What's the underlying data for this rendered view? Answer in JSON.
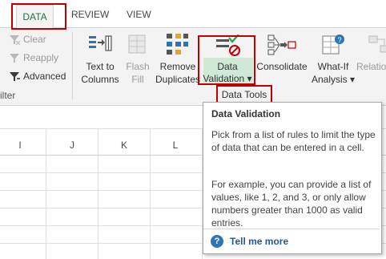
{
  "tabs": {
    "data": "DATA",
    "review": "REVIEW",
    "view": "VIEW"
  },
  "sort_filter": {
    "clear": "Clear",
    "reapply": "Reapply",
    "advanced": "Advanced",
    "group_label_partial": "ilter"
  },
  "buttons": {
    "text_to_columns": [
      "Text to",
      "Columns"
    ],
    "flash_fill": [
      "Flash",
      "Fill"
    ],
    "remove_duplicates": [
      "Remove",
      "Duplicates"
    ],
    "data_validation": [
      "Data",
      "Validation ▾"
    ],
    "consolidate": "Consolidate",
    "what_if": [
      "What-If",
      "Analysis ▾"
    ],
    "relationships_partial": "Relatio"
  },
  "group_label": "Data Tools",
  "columns": [
    "I",
    "J",
    "K",
    "L"
  ],
  "tooltip": {
    "title": "Data Validation",
    "para1": "Pick from a list of rules to limit the type of data that can be entered in a cell.",
    "para2": "For example, you can provide a list of values, like 1, 2, and 3, or only allow numbers greater than 1000 as valid entries.",
    "help_icon": "?",
    "link": "Tell me more"
  },
  "colors": {
    "accent_red": "#c00000",
    "excel_green": "#217346",
    "link_blue": "#1e5a9a"
  }
}
